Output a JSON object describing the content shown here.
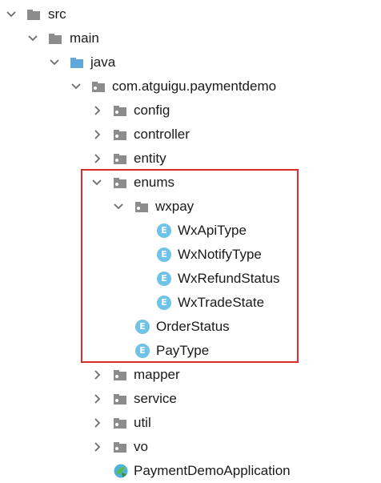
{
  "tree": {
    "items": [
      {
        "label": "src",
        "icon": "folder-gray-icon",
        "expanded": true
      },
      {
        "label": "main",
        "icon": "folder-gray-icon",
        "expanded": true
      },
      {
        "label": "java",
        "icon": "folder-blue-icon",
        "expanded": true
      },
      {
        "label": "com.atguigu.paymentdemo",
        "icon": "package-icon",
        "expanded": true
      },
      {
        "label": "config",
        "icon": "package-icon",
        "expanded": false
      },
      {
        "label": "controller",
        "icon": "package-icon",
        "expanded": false
      },
      {
        "label": "entity",
        "icon": "package-icon",
        "expanded": false
      },
      {
        "label": "enums",
        "icon": "package-icon",
        "expanded": true
      },
      {
        "label": "wxpay",
        "icon": "package-icon",
        "expanded": true
      },
      {
        "label": "WxApiType",
        "icon": "enum-icon"
      },
      {
        "label": "WxNotifyType",
        "icon": "enum-icon"
      },
      {
        "label": "WxRefundStatus",
        "icon": "enum-icon"
      },
      {
        "label": "WxTradeState",
        "icon": "enum-icon"
      },
      {
        "label": "OrderStatus",
        "icon": "enum-icon"
      },
      {
        "label": "PayType",
        "icon": "enum-icon"
      },
      {
        "label": "mapper",
        "icon": "package-icon",
        "expanded": false
      },
      {
        "label": "service",
        "icon": "package-icon",
        "expanded": false
      },
      {
        "label": "util",
        "icon": "package-icon",
        "expanded": false
      },
      {
        "label": "vo",
        "icon": "package-icon",
        "expanded": false
      },
      {
        "label": "PaymentDemoApplication",
        "icon": "spring-app-icon"
      }
    ],
    "enum_badge_letter": "E"
  },
  "colors": {
    "highlight_border": "#e02b2b",
    "folder_gray": "#8c8c8c",
    "folder_blue": "#5fa8d9",
    "enum_badge": "#6fc3e8"
  }
}
